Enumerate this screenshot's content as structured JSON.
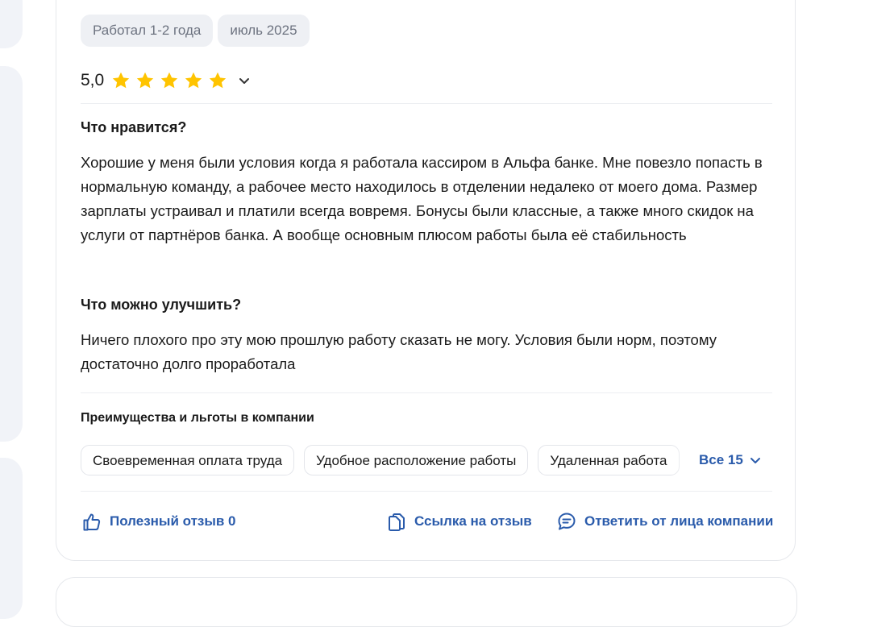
{
  "review": {
    "tags": [
      "Работал 1-2 года",
      "июль 2025"
    ],
    "rating": "5,0",
    "stars_filled": 5,
    "stars_total": 5,
    "star_color": "#ffc400",
    "likes_heading": "Что нравится?",
    "likes_text": "Хорошие у меня были условия когда я работала кассиром в Альфа банке. Мне повезло попасть в нормальную команду, а рабочее место находилось в отделении недалеко от моего дома. Размер зарплаты устраивал и платили всегда вовремя. Бонусы были классные, а также много скидок на услуги от партнёров банка. А вообще основным плюсом работы была её стабильность",
    "improve_heading": "Что можно улучшить?",
    "improve_text": "Ничего плохого про эту мою прошлую работу сказать не могу. Условия были норм, поэтому достаточно долго проработала",
    "benefits_heading": "Преимущества и льготы в компании",
    "benefits": [
      "Своевременная оплата труда",
      "Удобное расположение работы",
      "Удаленная работа"
    ],
    "benefits_all": "Все 15",
    "actions": {
      "useful": "Полезный отзыв 0",
      "link": "Ссылка на отзыв",
      "reply": "Ответить от лица компании"
    },
    "accent_color": "#2a5bab"
  }
}
